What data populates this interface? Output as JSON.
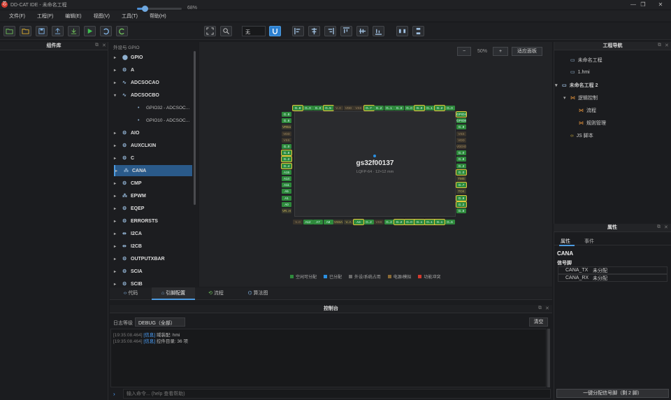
{
  "app": {
    "icon_text": "芯",
    "title": "DD-CAT IDE - 未命名工程"
  },
  "window_controls": [
    "—",
    "❐",
    "✕"
  ],
  "menu": [
    "文件(F)",
    "工程(P)",
    "编辑(E)",
    "视图(V)",
    "工具(T)",
    "帮助(H)"
  ],
  "toolbar": {
    "zoom": "68%",
    "mode": "无"
  },
  "left_panel": {
    "title": "组件库"
  },
  "peripherals": {
    "title": "外设与 GPIO",
    "items": [
      {
        "label": "GPIO",
        "arrow": "▸",
        "icon": "⬤"
      },
      {
        "label": "A",
        "arrow": "▸",
        "icon": "⚙"
      },
      {
        "label": "ADCSOCAO",
        "arrow": "▸",
        "icon": "∿"
      },
      {
        "label": "ADCSOCBO",
        "arrow": "▾",
        "icon": "∿"
      },
      {
        "label": "GPIO32 - ADCSOC...",
        "arrow": "",
        "icon": "•"
      },
      {
        "label": "GPIO10 - ADCSOC...",
        "arrow": "",
        "icon": "•"
      },
      {
        "label": "AIO",
        "arrow": "▸",
        "icon": "⚙"
      },
      {
        "label": "AUXCLKIN",
        "arrow": "▸",
        "icon": "⚙"
      },
      {
        "label": "C",
        "arrow": "▸",
        "icon": "⚙"
      },
      {
        "label": "CANA",
        "arrow": "▸",
        "icon": "⁂"
      },
      {
        "label": "CMP",
        "arrow": "▸",
        "icon": "⚙"
      },
      {
        "label": "EPWM",
        "arrow": "▸",
        "icon": "⁂"
      },
      {
        "label": "EQEP",
        "arrow": "▸",
        "icon": "⚙"
      },
      {
        "label": "ERRORSTS",
        "arrow": "▸",
        "icon": "⚙"
      },
      {
        "label": "I2CA",
        "arrow": "▸",
        "icon": "⇹"
      },
      {
        "label": "I2CB",
        "arrow": "▸",
        "icon": "⇹"
      },
      {
        "label": "OUTPUTXBAR",
        "arrow": "▸",
        "icon": "⚙"
      },
      {
        "label": "SCIA",
        "arrow": "▸",
        "icon": "⚙"
      },
      {
        "label": "SCIB",
        "arrow": "▸",
        "icon": "⚙"
      }
    ]
  },
  "canvas": {
    "zoom_out": "−",
    "zoom_pct": "50%",
    "zoom_in": "+",
    "fit": "适应面板"
  },
  "chip": {
    "name": "gs32f00137",
    "package": "LQFP-64 · 12×12 mm",
    "top_pins": [
      "G..8",
      "G..0",
      "G..0",
      "G..5",
      "V..0",
      "VDD",
      "VSS",
      "G..7",
      "G..2",
      "G..1",
      "G..0",
      "G..0",
      "G..0",
      "G..1",
      "G..2",
      "G..0"
    ],
    "bottom_pins": [
      "V..0",
      "A12",
      "A7",
      "A8",
      "VSSA",
      "V..A",
      "A4",
      "G..2",
      "VSS",
      "G..2",
      "G..2",
      "G..0",
      "G..1",
      "G..1",
      "G..1",
      "G..6"
    ],
    "left_pins": [
      "G..8",
      "G..6",
      "VREa",
      "VDD",
      "VSS",
      "G..0",
      "G..8",
      "G..2",
      "G..4",
      "A15",
      "A14",
      "A11",
      "A5",
      "A1",
      "A0",
      "VR..H"
    ],
    "right_pins": [
      "GPIO4",
      "GPIO8",
      "G..9",
      "VSS",
      "VDD",
      "VDDIO",
      "G..0",
      "G..8",
      "G..2",
      "G..0",
      "TMS",
      "G..7",
      "TCK",
      "G..9",
      "G..2",
      "G..6"
    ]
  },
  "legend": [
    {
      "label": "空闲可分配",
      "color": "#2f8a3c"
    },
    {
      "label": "已分配",
      "color": "#2b8fe0"
    },
    {
      "label": "外设/系统占用",
      "color": "#6b6b6b"
    },
    {
      "label": "电源/模拟",
      "color": "#8a6a35"
    },
    {
      "label": "功能冲突",
      "color": "#d33a2e"
    }
  ],
  "bottom_tabs": [
    {
      "label": "代码",
      "icon": "‹›"
    },
    {
      "label": "引脚配置",
      "icon": "⌂"
    },
    {
      "label": "流程",
      "icon": "⟲"
    },
    {
      "label": "算法图",
      "icon": "⌬"
    }
  ],
  "console": {
    "title": "控制台",
    "level_label": "日志等级",
    "level": "DEBUG（全部）",
    "clear": "清空",
    "logs": [
      {
        "ts": "[19:35:08.464]",
        "tag": "[信息]",
        "msg": " 域装配: hmi"
      },
      {
        "ts": "[19:35:08.464]",
        "tag": "[信息]",
        "msg": " 控件目录: 36 项"
      }
    ],
    "prompt": "›",
    "input_placeholder": "输入命令... (help 查看帮助)"
  },
  "project_nav": {
    "title": "工程导航",
    "items": [
      {
        "label": "未命名工程",
        "icon": "▭",
        "arrow": ""
      },
      {
        "label": "1.hmi",
        "icon": "▭",
        "arrow": ""
      },
      {
        "label": "未命名工程 2",
        "icon": "▭",
        "arrow": "▾"
      },
      {
        "label": "逻辑控制",
        "icon": "⋈",
        "arrow": "▾"
      },
      {
        "label": "流程",
        "icon": "⋈",
        "arrow": ""
      },
      {
        "label": "规则管理",
        "icon": "⋈",
        "arrow": ""
      },
      {
        "label": "JS 脚本",
        "icon": "‹›",
        "arrow": ""
      }
    ]
  },
  "properties": {
    "title": "属性",
    "tabs": [
      "属性",
      "事件"
    ],
    "component": "CANA",
    "group": "信号脚",
    "rows": [
      {
        "key": "CANA_TX",
        "value": "未分配"
      },
      {
        "key": "CANA_RX",
        "value": "未分配"
      }
    ],
    "auto_assign": "一键分配信号脚（剩 2 脚）"
  }
}
